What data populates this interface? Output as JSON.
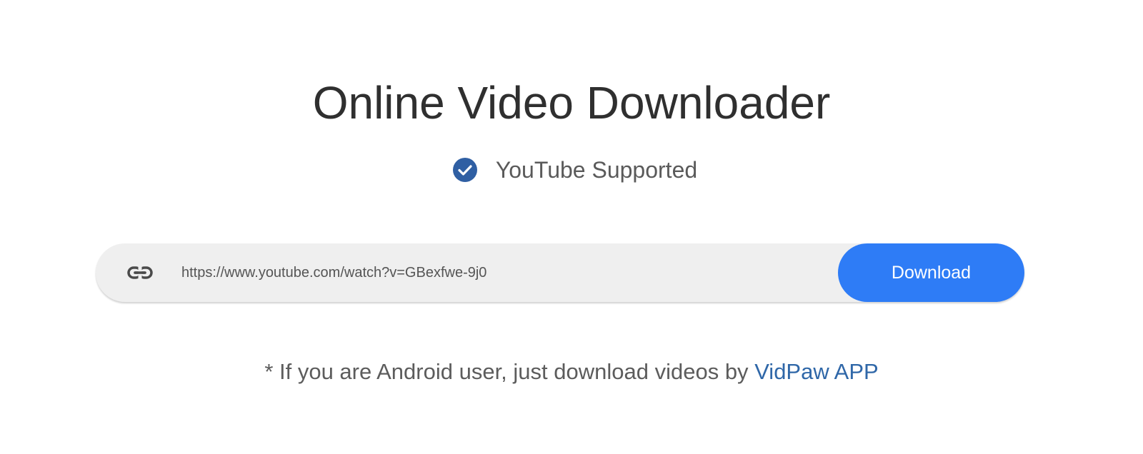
{
  "hero": {
    "title": "Online Video Downloader",
    "supported_label": "YouTube Supported",
    "check_icon": "check-circle-icon"
  },
  "search": {
    "link_icon": "link-icon",
    "url_value": "https://www.youtube.com/watch?v=GBexfwe-9j0",
    "download_label": "Download"
  },
  "note": {
    "text": "* If you are Android user, just download videos by ",
    "link_text": "VidPaw APP"
  },
  "colors": {
    "accent": "#2e7cf6",
    "check": "#2f5fa3",
    "link": "#2f67a8",
    "input_bg": "#efefef",
    "title_text": "#2f2f2f"
  }
}
